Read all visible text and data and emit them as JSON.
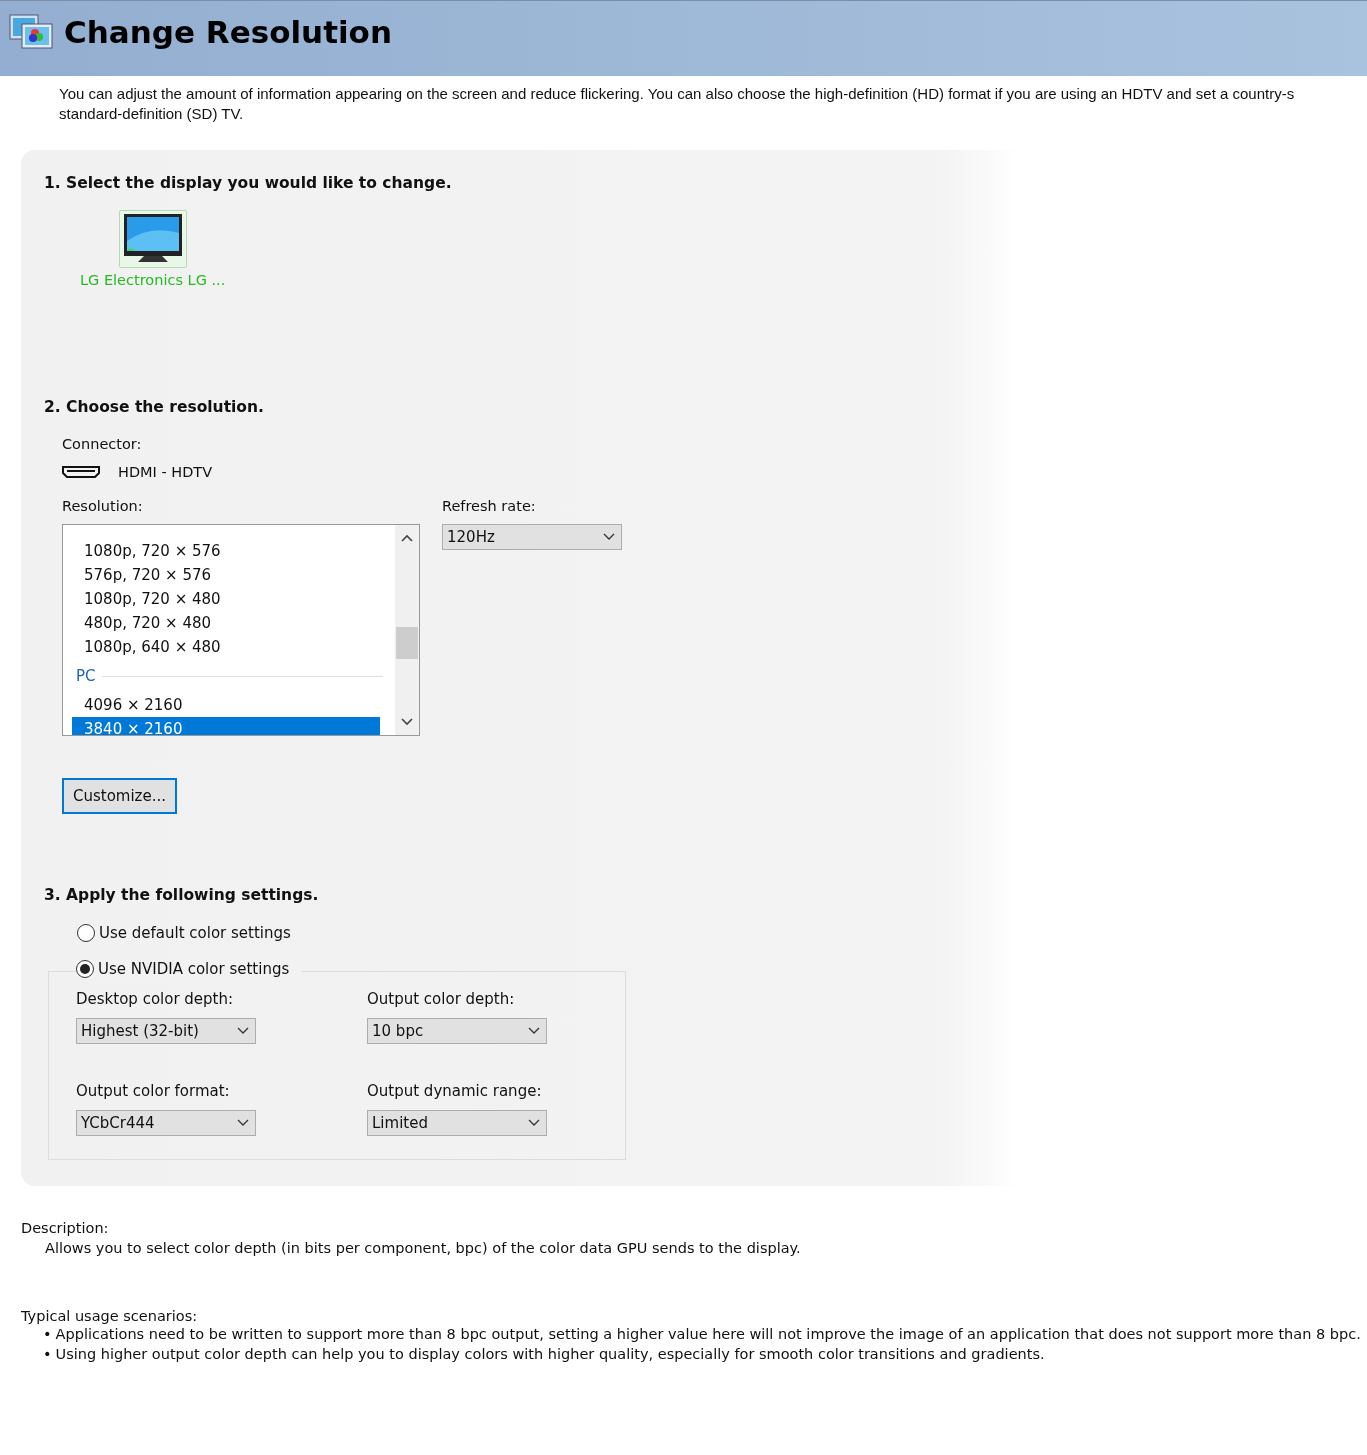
{
  "header": {
    "title": "Change Resolution"
  },
  "intro": [
    "You can adjust the amount of information appearing on the screen and reduce flickering. You can also choose the high-definition (HD) format if you are using an HDTV and set a country-s",
    "standard-definition (SD) TV."
  ],
  "step1": {
    "heading": "1. Select the display you would like to change.",
    "displays": [
      {
        "label": "LG Electronics LG ...",
        "selected": true
      }
    ]
  },
  "step2": {
    "heading": "2. Choose the resolution.",
    "connector_label": "Connector:",
    "connector": "HDMI - HDTV",
    "resolution_label": "Resolution:",
    "resolutions": [
      {
        "kind": "item",
        "label": "1080p, 720 × 576",
        "selected": false
      },
      {
        "kind": "item",
        "label": "576p, 720 × 576",
        "selected": false
      },
      {
        "kind": "item",
        "label": "1080p, 720 × 480",
        "selected": false
      },
      {
        "kind": "item",
        "label": "480p, 720 × 480",
        "selected": false
      },
      {
        "kind": "item",
        "label": "1080p, 640 × 480",
        "selected": false
      },
      {
        "kind": "group",
        "label": "PC"
      },
      {
        "kind": "item",
        "label": "4096 × 2160",
        "selected": false
      },
      {
        "kind": "item",
        "label": "3840 × 2160",
        "selected": true
      }
    ],
    "refresh_label": "Refresh rate:",
    "refresh_rate": "120Hz",
    "customize_button": "Customize..."
  },
  "step3": {
    "heading": "3. Apply the following settings.",
    "options": [
      {
        "label": "Use default color settings",
        "selected": false
      },
      {
        "label": "Use NVIDIA color settings",
        "selected": true
      }
    ],
    "settings": [
      {
        "label": "Desktop color depth:",
        "value": "Highest (32-bit)"
      },
      {
        "label": "Output color depth:",
        "value": "10 bpc"
      },
      {
        "label": "Output color format:",
        "value": "YCbCr444"
      },
      {
        "label": "Output dynamic range:",
        "value": "Limited"
      }
    ]
  },
  "description": {
    "label": "Description:",
    "text": "Allows you to select color depth (in bits per component, bpc) of the color data GPU sends to the display."
  },
  "usage": {
    "label": "Typical usage scenarios:",
    "items": [
      {
        "bullet": "•",
        "text": "Applications need to be written to support more than 8 bpc output, setting a higher value here will not improve the image of an application that does not support more than 8 bpc."
      },
      {
        "bullet": "•",
        "text": "Using higher output color depth can help you to display colors with higher quality, especially for smooth color transitions and gradients."
      }
    ]
  }
}
